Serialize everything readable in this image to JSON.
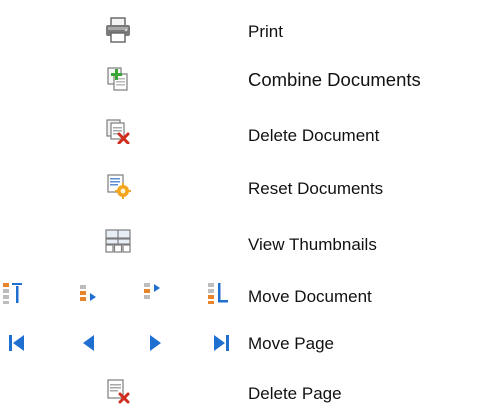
{
  "legend": {
    "print_label": "Print",
    "combine_label": "Combine Documents",
    "delete_document_label": "Delete Document",
    "reset_documents_label": "Reset Documents",
    "view_thumbnails_label": "View Thumbnails",
    "move_document_label": "Move Document",
    "move_page_label": "Move Page",
    "delete_page_label": "Delete Page"
  },
  "icons": {
    "print": "printer-icon",
    "combine": "combine-documents-icon",
    "delete_document": "delete-document-icon",
    "reset_documents": "reset-documents-icon",
    "view_thumbnails": "view-thumbnails-icon",
    "move_document": [
      "move-to-top-icon",
      "move-up-icon",
      "move-down-icon",
      "move-to-bottom-icon"
    ],
    "move_page": [
      "first-page-icon",
      "previous-page-icon",
      "next-page-icon",
      "last-page-icon"
    ],
    "delete_page": "delete-page-icon"
  },
  "colors": {
    "accent_blue": "#1f6fd1",
    "add_green": "#3aa635",
    "delete_red": "#d02d1f",
    "reset_orange": "#f2a51d",
    "move_orange": "#e8842a"
  }
}
